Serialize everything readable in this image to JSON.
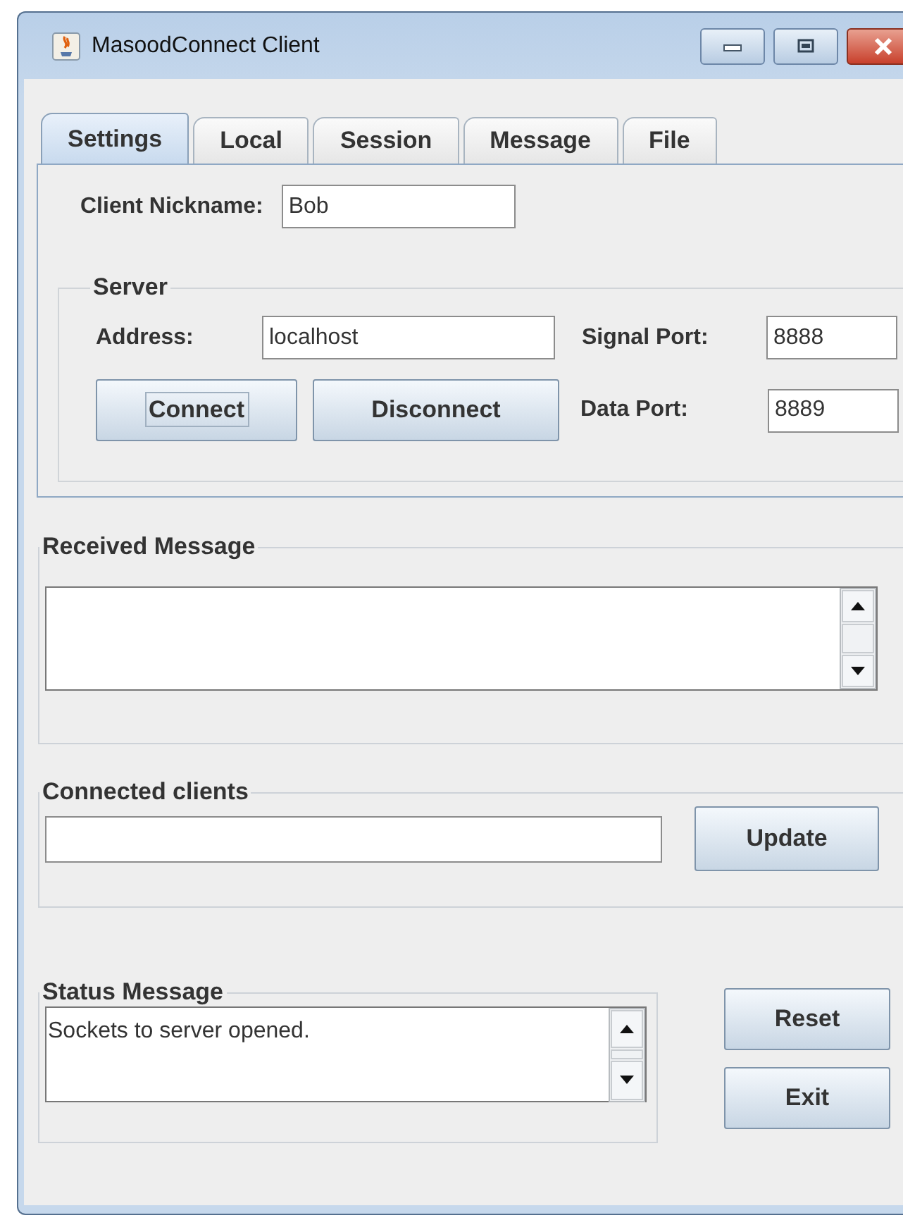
{
  "window": {
    "title": "MasoodConnect Client"
  },
  "tabs": [
    {
      "label": "Settings",
      "selected": true
    },
    {
      "label": "Local",
      "selected": false
    },
    {
      "label": "Session",
      "selected": false
    },
    {
      "label": "Message",
      "selected": false
    },
    {
      "label": "File",
      "selected": false
    }
  ],
  "settings": {
    "nickname_label": "Client Nickname:",
    "nickname": "Bob",
    "server": {
      "title": "Server",
      "address_label": "Address:",
      "address": "localhost",
      "signal_port_label": "Signal Port:",
      "signal_port": "8888",
      "data_port_label": "Data Port:",
      "data_port": "8889",
      "connect": "Connect",
      "disconnect": "Disconnect"
    }
  },
  "received_message": {
    "title": "Received Message"
  },
  "connected_clients": {
    "title": "Connected clients",
    "update": "Update"
  },
  "status_message": {
    "title": "Status Message",
    "text": "Sockets to server opened."
  },
  "buttons": {
    "reset": "Reset",
    "exit": "Exit"
  }
}
